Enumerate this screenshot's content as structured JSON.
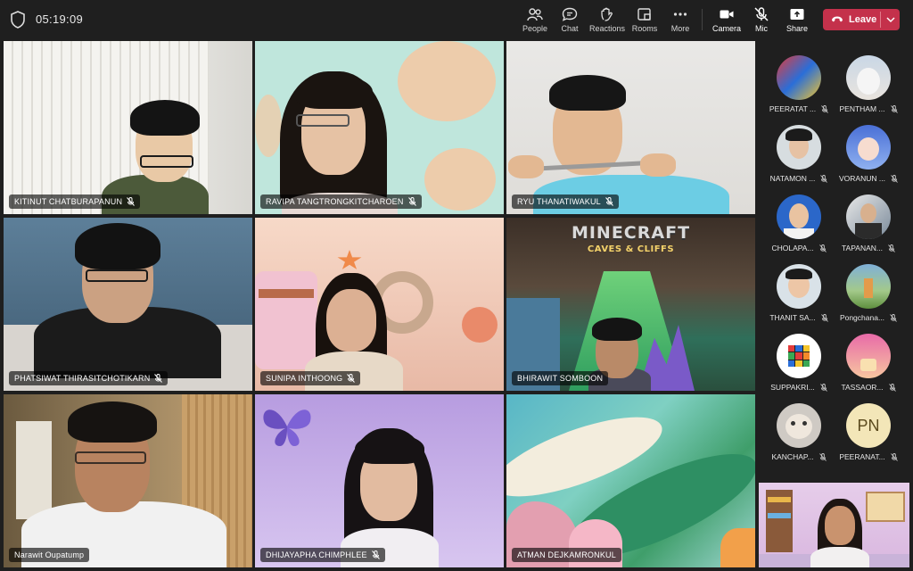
{
  "meeting": {
    "elapsed_time": "05:19:09"
  },
  "toolbar": {
    "people_label": "People",
    "chat_label": "Chat",
    "reactions_label": "Reactions",
    "rooms_label": "Rooms",
    "more_label": "More",
    "camera_label": "Camera",
    "mic_label": "Mic",
    "share_label": "Share",
    "leave_label": "Leave"
  },
  "tiles": [
    {
      "name": "KITINUT CHATBURAPANUN",
      "muted": true
    },
    {
      "name": "RAVIPA TANGTRONGKITCHAROEN",
      "muted": true
    },
    {
      "name": "RYU THANATIWAKUL",
      "muted": true
    },
    {
      "name": "PHATSIWAT THIRASITCHOTIKARN",
      "muted": true
    },
    {
      "name": "SUNIPA INTHOONG",
      "muted": true
    },
    {
      "name": "BHIRAWIT SOMBOON",
      "muted": false
    },
    {
      "name": "Narawit Oupatump",
      "muted": false,
      "active_speaker": true
    },
    {
      "name": "DHIJAYAPHA CHIMPHLEE",
      "muted": true
    },
    {
      "name": "ATMAN DEJKAMRONKUL",
      "muted": false
    }
  ],
  "backgrounds": {
    "tile5_line1": "MINECRAFT",
    "tile5_line2": "CAVES & CLIFFS"
  },
  "participants": [
    {
      "name": "PEERATAT ...",
      "muted": true
    },
    {
      "name": "PENTHAM ...",
      "muted": true
    },
    {
      "name": "NATAMON ...",
      "muted": true
    },
    {
      "name": "VORANUN ...",
      "muted": true
    },
    {
      "name": "CHOLAPA...",
      "muted": true
    },
    {
      "name": "TAPANAN...",
      "muted": true
    },
    {
      "name": "THANIT SA...",
      "muted": true
    },
    {
      "name": "Pongchana...",
      "muted": true
    },
    {
      "name": "SUPPAKRI...",
      "muted": true
    },
    {
      "name": "TASSAOR...",
      "muted": true
    },
    {
      "name": "KANCHAP...",
      "muted": true
    },
    {
      "name": "PEERANAT...",
      "muted": true,
      "initials": "PN"
    }
  ],
  "colors": {
    "leave": "#c4314b",
    "active_speaker_border": "#7f85f5",
    "background": "#1f1f1f"
  }
}
